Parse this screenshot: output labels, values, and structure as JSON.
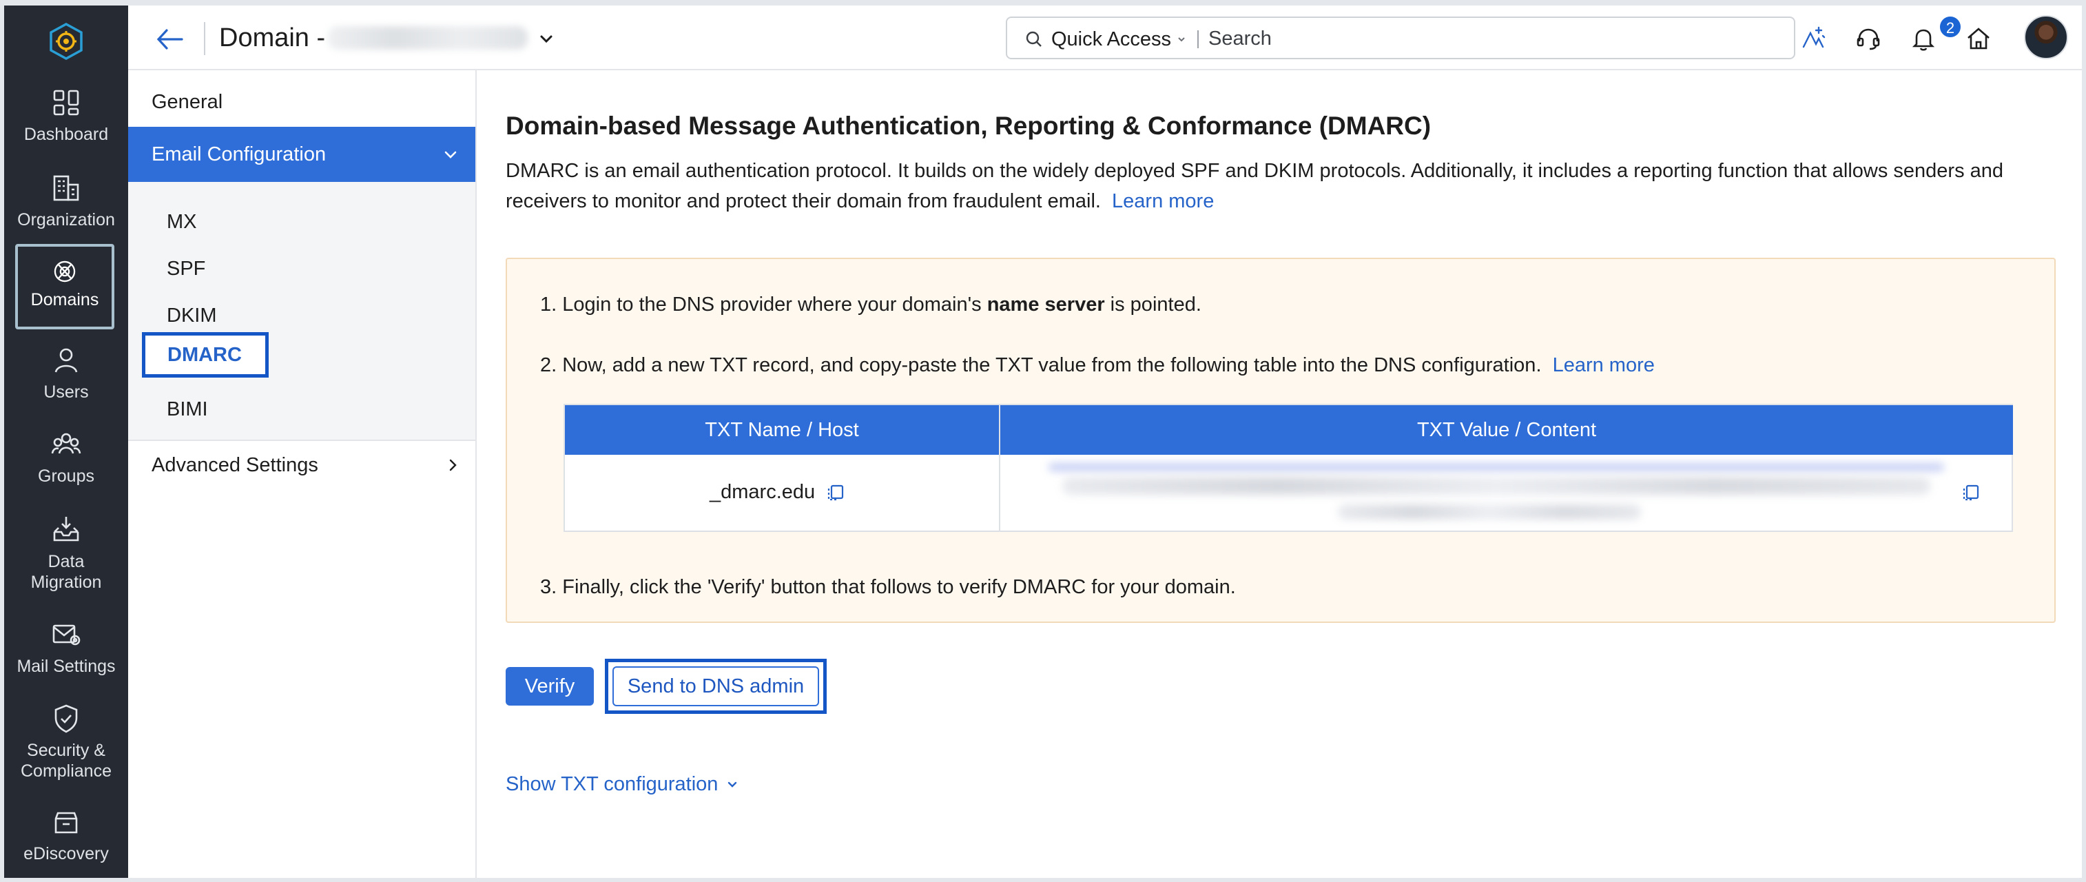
{
  "colors": {
    "rail_bg": "#262b33",
    "accent": "#2f6dd8",
    "link": "#2563c9",
    "highlight_border": "#1456c6",
    "notice_bg": "#fff8ef",
    "badge": "#1a64d4"
  },
  "rail": {
    "logo_icon": "app-logo-icon",
    "items": [
      {
        "label": "Dashboard",
        "icon": "dashboard-icon"
      },
      {
        "label": "Organization",
        "icon": "organization-icon"
      },
      {
        "label": "Domains",
        "icon": "globe-icon",
        "active": true
      },
      {
        "label": "Users",
        "icon": "user-icon"
      },
      {
        "label": "Groups",
        "icon": "groups-icon"
      },
      {
        "label": "Data\nMigration",
        "icon": "data-migration-icon"
      },
      {
        "label": "Mail Settings",
        "icon": "mail-settings-icon"
      },
      {
        "label": "Security &\nCompliance",
        "icon": "shield-icon"
      },
      {
        "label": "eDiscovery",
        "icon": "ediscovery-icon"
      }
    ]
  },
  "header": {
    "title": "Domain -",
    "search": {
      "quick_access": "Quick Access",
      "placeholder": "Search"
    },
    "notifications_count": "2",
    "icons": [
      "back-arrow-icon",
      "search-icon",
      "whats-new-icon",
      "headset-icon",
      "bell-icon",
      "home-icon",
      "avatar"
    ]
  },
  "subnav": {
    "general": "General",
    "email_configuration": "Email Configuration",
    "email_items": [
      "MX",
      "SPF",
      "DKIM",
      "DMARC",
      "BIMI"
    ],
    "selected": "DMARC",
    "advanced_settings": "Advanced Settings"
  },
  "main": {
    "heading": "Domain-based Message Authentication, Reporting & Conformance (DMARC)",
    "description": "DMARC is an email authentication protocol. It builds on the widely deployed SPF and DKIM protocols. Additionally, it includes a reporting function that allows senders and receivers to monitor and protect their domain from fraudulent email.",
    "learn_more": "Learn more",
    "steps": {
      "step1_prefix": "1. Login to the DNS provider where your domain's ",
      "step1_bold": "name server",
      "step1_suffix": " is pointed.",
      "step2": "2. Now, add a new TXT record, and copy-paste the TXT value from the following table into the DNS configuration.",
      "step2_link": "Learn more",
      "step3": "3. Finally, click the 'Verify' button that follows to verify DMARC for your domain."
    },
    "table": {
      "col_name": "TXT Name / Host",
      "col_value": "TXT Value / Content",
      "row_name": "_dmarc.edu"
    },
    "verify_label": "Verify",
    "send_label": "Send to DNS admin",
    "show_txt": "Show TXT configuration"
  }
}
